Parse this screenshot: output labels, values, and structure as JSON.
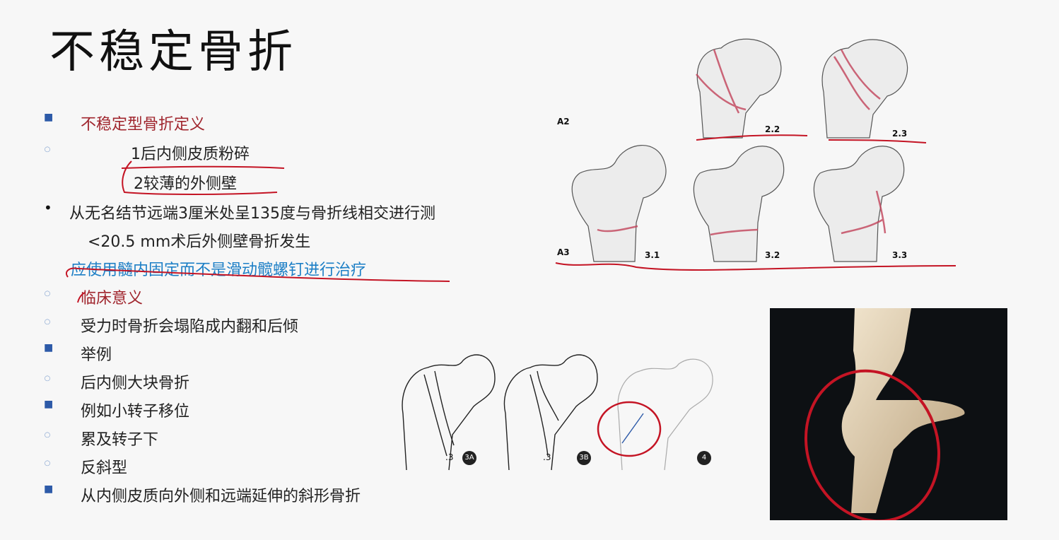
{
  "title": "不稳定骨折",
  "items": [
    {
      "text": "不稳定型骨折定义",
      "bullet": "square",
      "color": "red"
    },
    {
      "text": "1后内侧皮质粉碎",
      "bullet": "circle",
      "color": "dark"
    },
    {
      "text": "2较薄的外侧壁",
      "bullet": "none",
      "color": "dark"
    },
    {
      "text": "从无名结节远端3厘米处呈135度与骨折线相交进行测",
      "bullet": "dot",
      "color": "dark"
    },
    {
      "text": "<20.5 mm术后外侧壁骨折发生",
      "bullet": "none",
      "color": "dark"
    },
    {
      "text": "应使用髓内固定而不是滑动髋螺钉进行治疗",
      "bullet": "none",
      "color": "blue"
    },
    {
      "text": "临床意义",
      "bullet": "circle",
      "color": "red"
    },
    {
      "text": "受力时骨折会塌陷成内翻和后倾",
      "bullet": "circle",
      "color": "dark"
    },
    {
      "text": "举例",
      "bullet": "square",
      "color": "dark"
    },
    {
      "text": "后内侧大块骨折",
      "bullet": "circle",
      "color": "dark"
    },
    {
      "text": "例如小转子移位",
      "bullet": "square",
      "color": "dark"
    },
    {
      "text": "累及转子下",
      "bullet": "circle",
      "color": "dark"
    },
    {
      "text": "反斜型",
      "bullet": "circle",
      "color": "dark"
    },
    {
      "text": "从内侧皮质向外侧和远端延伸的斜形骨折",
      "bullet": "square",
      "color": "dark"
    }
  ],
  "classification_figure": {
    "row_labels": [
      "A2",
      "A3"
    ],
    "subtype_labels": [
      "2.2",
      "2.3",
      "3.1",
      "3.2",
      "3.3"
    ]
  },
  "lower_figure": {
    "labels": [
      ".3",
      "3A",
      ".3",
      "3B",
      "4"
    ]
  },
  "colors": {
    "title": "#111111",
    "red_text": "#a0262e",
    "blue_text": "#1d7fc6",
    "annotation_red": "#c41424",
    "bullet_blue": "#2d5aa8"
  }
}
